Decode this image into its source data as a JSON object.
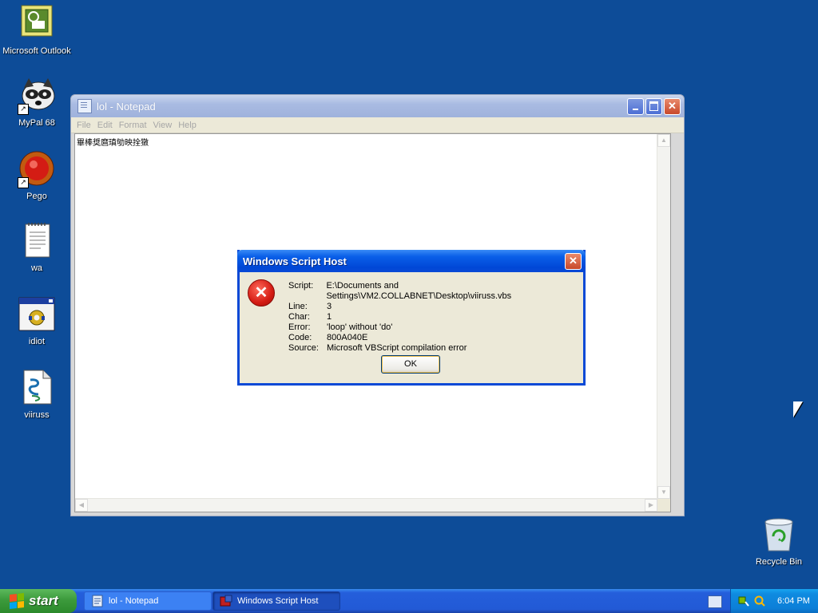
{
  "desktop": {
    "icons": [
      {
        "label": "Microsoft Outlook",
        "icon": "outlook-icon"
      },
      {
        "label": "MyPal 68",
        "icon": "mypal-raccoon-icon"
      },
      {
        "label": "Pego",
        "icon": "pego-red-button-icon"
      },
      {
        "label": "wa",
        "icon": "text-document-icon"
      },
      {
        "label": "idiot",
        "icon": "application-gear-icon"
      },
      {
        "label": "viiruss",
        "icon": "script-file-icon"
      },
      {
        "label": "Recycle Bin",
        "icon": "recycle-bin-icon"
      }
    ]
  },
  "notepad": {
    "title": "lol - Notepad",
    "menu": [
      "File",
      "Edit",
      "Format",
      "View",
      "Help"
    ],
    "content": "畢棒奨麿瑱劬映拴獤"
  },
  "dialog": {
    "title": "Windows Script Host",
    "fields": [
      {
        "key": "Script:",
        "value": "E:\\Documents and Settings\\VM2.COLLABNET\\Desktop\\viiruss.vbs"
      },
      {
        "key": "Line:",
        "value": "3"
      },
      {
        "key": "Char:",
        "value": "1"
      },
      {
        "key": "Error:",
        "value": "'loop' without 'do'"
      },
      {
        "key": "Code:",
        "value": "800A040E"
      },
      {
        "key": "Source:",
        "value": "Microsoft VBScript compilation error"
      }
    ],
    "ok_label": "OK"
  },
  "taskbar": {
    "start_label": "start",
    "tasks": [
      {
        "label": "lol - Notepad",
        "active": false
      },
      {
        "label": "Windows Script Host",
        "active": true
      }
    ],
    "clock": "6:04 PM"
  },
  "colors": {
    "desktop_bg": "#0d4c98",
    "dialog_title": "#0a5fe8",
    "error_red": "#d41c14"
  }
}
